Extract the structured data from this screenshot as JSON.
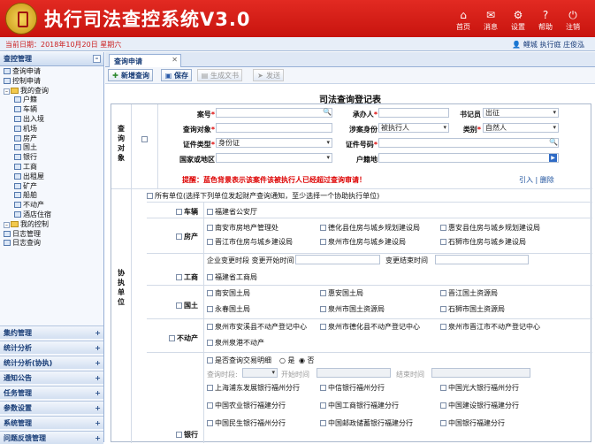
{
  "header": {
    "title": "执行司法查控系统V3.0",
    "toolbar": [
      {
        "label": "首页",
        "icon": "home-icon",
        "glyph": "⌂"
      },
      {
        "label": "消息",
        "icon": "mail-icon",
        "glyph": "✉"
      },
      {
        "label": "设置",
        "icon": "gear-icon",
        "glyph": "⚙"
      },
      {
        "label": "帮助",
        "icon": "help-icon",
        "glyph": "?"
      },
      {
        "label": "注销",
        "icon": "power-icon",
        "glyph": "⏻"
      }
    ]
  },
  "status": {
    "date_label": "当前日期：",
    "date": "2018年10月20日",
    "weekday": "星期六",
    "user": "鲤城 执行庭 庄俊泓"
  },
  "sidebar": {
    "title": "查控管理",
    "tree": [
      {
        "label": "查询申请",
        "level": 1,
        "kind": "leaf"
      },
      {
        "label": "控制申请",
        "level": 1,
        "kind": "leaf"
      },
      {
        "label": "我的查询",
        "level": 1,
        "kind": "folder"
      },
      {
        "label": "户籍",
        "level": 2,
        "kind": "leaf"
      },
      {
        "label": "车辆",
        "level": 2,
        "kind": "leaf"
      },
      {
        "label": "出入境",
        "level": 2,
        "kind": "leaf"
      },
      {
        "label": "机场",
        "level": 2,
        "kind": "leaf"
      },
      {
        "label": "房产",
        "level": 2,
        "kind": "leaf"
      },
      {
        "label": "国土",
        "level": 2,
        "kind": "leaf"
      },
      {
        "label": "银行",
        "level": 2,
        "kind": "leaf"
      },
      {
        "label": "工商",
        "level": 2,
        "kind": "leaf"
      },
      {
        "label": "出租屋",
        "level": 2,
        "kind": "leaf"
      },
      {
        "label": "矿产",
        "level": 2,
        "kind": "leaf"
      },
      {
        "label": "船舶",
        "level": 2,
        "kind": "leaf"
      },
      {
        "label": "不动产",
        "level": 2,
        "kind": "leaf"
      },
      {
        "label": "酒店住宿",
        "level": 2,
        "kind": "leaf"
      },
      {
        "label": "我的控制",
        "level": 1,
        "kind": "folder"
      },
      {
        "label": "日志管理",
        "level": 1,
        "kind": "leaf"
      },
      {
        "label": "日志查询",
        "level": 1,
        "kind": "leaf"
      }
    ],
    "sections": [
      "集约管理",
      "统计分析",
      "统计分析(协执)",
      "通知公告",
      "任务管理",
      "参数设置",
      "系统管理",
      "问题反馈管理"
    ]
  },
  "main": {
    "tab": "查询申请",
    "buttons": [
      {
        "label": "新增查询",
        "icon": "new-icon",
        "glyph": "✚",
        "disabled": false
      },
      {
        "label": "保存",
        "icon": "save-icon",
        "glyph": "▣",
        "disabled": false
      },
      {
        "label": "生成文书",
        "icon": "document-icon",
        "glyph": "▤",
        "disabled": true
      },
      {
        "label": "发送",
        "icon": "send-icon",
        "glyph": "➤",
        "disabled": true
      }
    ],
    "form_title": "司法查询登记表",
    "object_section": "查询对象",
    "fields": {
      "case_no": "案号",
      "undertaker": "承办人",
      "clerk": "书记员",
      "clerk_value": "出征",
      "query_object": "查询对象",
      "identity": "涉案身份",
      "identity_value": "被执行人",
      "category": "类别",
      "category_value": "自然人",
      "id_type": "证件类型",
      "id_type_value": "身份证",
      "id_no": "证件号码",
      "country": "国家或地区",
      "domicile": "户籍地"
    },
    "warning": "提醒：蓝色背景表示该案件该被执行人已经超过查询审请！",
    "link_import": "引入",
    "link_delete": "删除",
    "units_section": "协执单位",
    "all_units": "所有单位(选择下列单位发起财产查询通知，至少选择一个协助执行单位)",
    "vehicle": {
      "label": "车辆",
      "items": [
        "福建省公安厅"
      ]
    },
    "property": {
      "label": "房产",
      "items": [
        "南安市房地产管理处",
        "德化县住房与城乡规划建设局",
        "惠安县住房与城乡规划建设局",
        "晋江市住房与城乡建设局",
        "泉州市住房与城乡建设局",
        "石狮市住房与城乡建设局"
      ]
    },
    "commerce": {
      "label": "工商",
      "change_time": "企业变更时段",
      "change_start": "变更开始时间",
      "change_end": "变更结束时间",
      "items": [
        "福建省工商局"
      ]
    },
    "land": {
      "label": "国土",
      "items": [
        "南安国土局",
        "惠安国土局",
        "晋江国土资源局",
        "永春国土局",
        "泉州市国土资源局",
        "石狮市国土资源局"
      ]
    },
    "realty": {
      "label": "不动产",
      "items": [
        "泉州市安溪县不动产登记中心",
        "泉州市德化县不动产登记中心",
        "泉州市晋江市不动产登记中心",
        "泉州泉港不动产"
      ]
    },
    "bank": {
      "label": "银行",
      "query_detail": "是否查询交易明细",
      "yes": "是",
      "no": "否",
      "q_period": "查询时段:",
      "start": "开始时间",
      "end": "结束时间",
      "items": [
        "上海浦东发展银行福州分行",
        "中信银行福州分行",
        "中国光大银行福州分行",
        "中国农业银行福建分行",
        "中国工商银行福建分行",
        "中国建设银行福建分行",
        "中国民生银行福州分行",
        "中国邮政储蓄银行福建分行",
        "中国银行福建分行"
      ]
    }
  },
  "colors": {
    "header_red": "#c8140e",
    "warning_red": "#d00000",
    "nav_blue": "#153a75"
  }
}
